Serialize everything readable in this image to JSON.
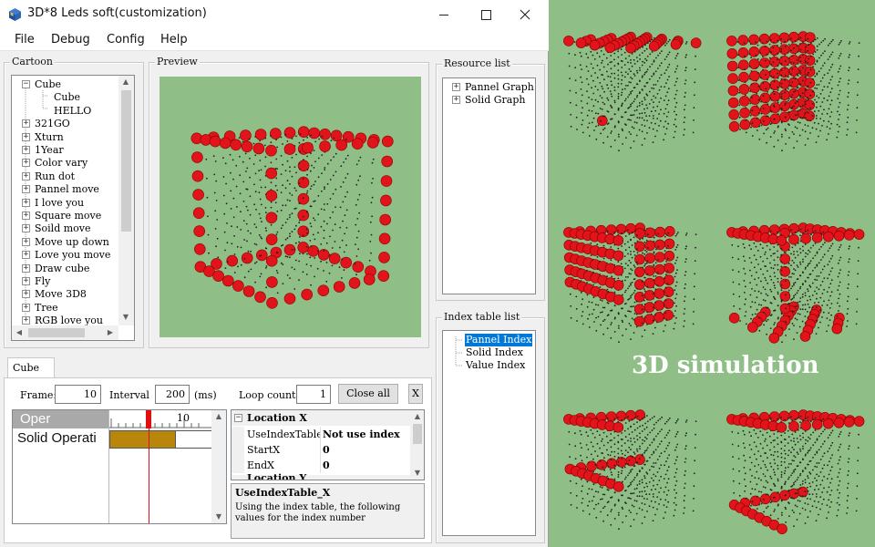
{
  "window": {
    "title": "3D*8 Leds soft(customization)",
    "controls": {
      "minimize": "—",
      "maximize": "☐",
      "close": "✕"
    }
  },
  "menu": [
    "File",
    "Debug",
    "Config",
    "Help"
  ],
  "cartoon": {
    "title": "Cartoon",
    "root": {
      "label": "Cube",
      "expander": "−",
      "children": [
        "Cube",
        "HELLO"
      ]
    },
    "items": [
      "321GO",
      "Xturn",
      "1Year",
      "Color vary",
      "Run dot",
      "Pannel move",
      "I love you",
      "Square move",
      "Soild move",
      "Move up down",
      "Love you move",
      "Draw cube",
      "Fly",
      "Move 3D8",
      "Tree",
      "RGB love you"
    ],
    "item_expander": "+"
  },
  "preview": {
    "title": "Preview"
  },
  "resource": {
    "title": "Resource list",
    "items": [
      "Pannel Graph",
      "Solid Graph"
    ],
    "expander": "+"
  },
  "index_table": {
    "title": "Index table list",
    "items": [
      "Pannel Index",
      "Solid Index",
      "Value Index"
    ],
    "selected": 0
  },
  "editor": {
    "tab": "Cube",
    "frame_label": "Frame:",
    "frame_value": "10",
    "interval_label": "Interval",
    "interval_value": "200",
    "interval_unit": "(ms)",
    "loop_label": "Loop count",
    "loop_value": "1",
    "close_all": "Close all",
    "close_x": "X",
    "grid_rows": [
      "Oper",
      "Solid Operati"
    ],
    "ruler_mark": "10",
    "track_fill_fraction": 0.65
  },
  "properties": {
    "section": "Location X",
    "collapse": "−",
    "rows": [
      {
        "key": "UseIndexTable",
        "value": "Not use index"
      },
      {
        "key": "StartX",
        "value": "0"
      },
      {
        "key": "EndX",
        "value": "0"
      }
    ],
    "next_section": "Location Y",
    "desc_title": "UseIndexTable_X",
    "desc_text": "Using the index table, the following values for the index number"
  },
  "scroll_arrows": {
    "up": "▲",
    "down": "▼",
    "left": "◀",
    "right": "▶"
  },
  "simulation": {
    "label": "3D simulation"
  },
  "colors": {
    "led": "#e0141a",
    "led_off": "#222222",
    "scene_bg": "#8fbf87",
    "selection": "#0078d7",
    "track_fill": "#b8860b"
  }
}
